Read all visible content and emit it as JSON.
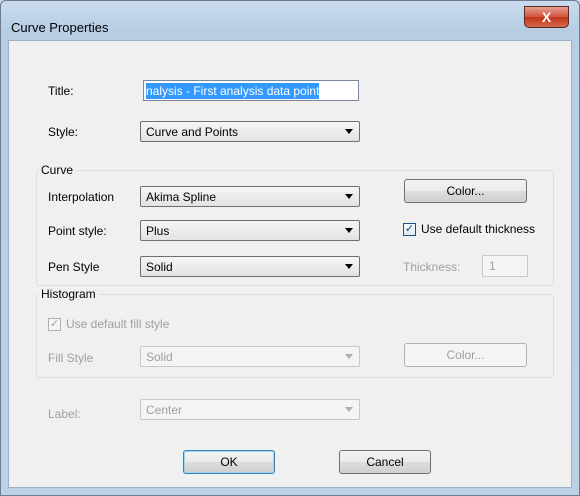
{
  "window": {
    "title": "Curve Properties",
    "close_label": "X"
  },
  "fields": {
    "title_label": "Title:",
    "title_value": "nalysis - First analysis data point",
    "style_label": "Style:",
    "style_value": "Curve and Points"
  },
  "curve": {
    "group_label": "Curve",
    "interpolation_label": "Interpolation",
    "interpolation_value": "Akima Spline",
    "point_style_label": "Point style:",
    "point_style_value": "Plus",
    "pen_style_label": "Pen Style",
    "pen_style_value": "Solid",
    "color_button": "Color...",
    "default_thickness_label": "Use default thickness",
    "default_thickness_checked": true,
    "thickness_label": "Thickness:",
    "thickness_value": "1"
  },
  "histogram": {
    "group_label": "Histogram",
    "default_fill_label": "Use default fill style",
    "default_fill_checked": true,
    "fill_style_label": "Fill Style",
    "fill_style_value": "Solid",
    "color_button": "Color..."
  },
  "label": {
    "label": "Label:",
    "value": "Center"
  },
  "actions": {
    "ok": "OK",
    "cancel": "Cancel"
  },
  "icons": {
    "check_glyph": "✓",
    "close": "close-icon",
    "dropdown": "chevron-down-icon"
  },
  "colors": {
    "selection": "#3399ff",
    "close_button": "#c2351b"
  }
}
